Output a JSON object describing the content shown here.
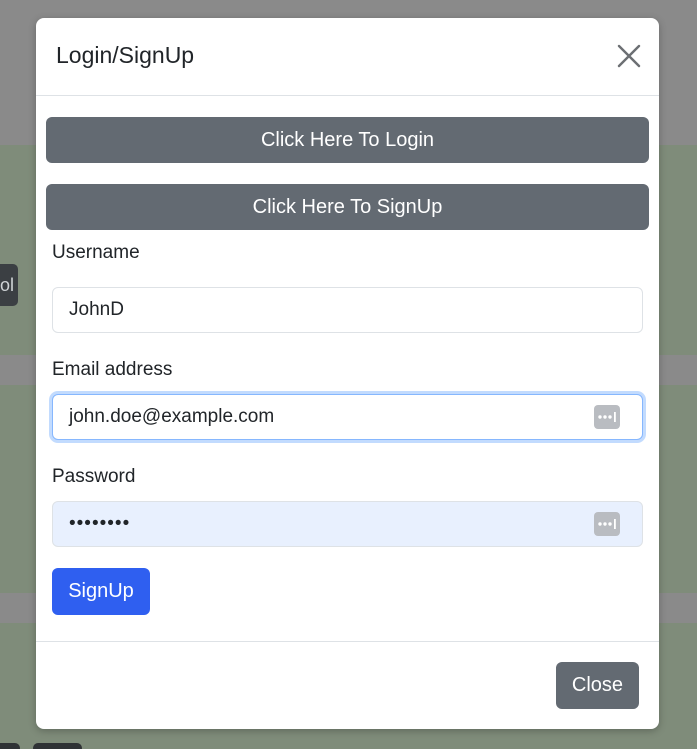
{
  "background": {
    "chip_text": "ol"
  },
  "modal": {
    "title": "Login/SignUp",
    "login_button": "Click Here To Login",
    "signup_toggle_button": "Click Here To SignUp",
    "username": {
      "label": "Username",
      "value": "JohnD"
    },
    "email": {
      "label": "Email address",
      "value": "john.doe@example.com"
    },
    "password": {
      "label": "Password",
      "value": "••••••••"
    },
    "submit_button": "SignUp",
    "close_button": "Close"
  },
  "colors": {
    "primary": "#2f5ff0",
    "secondary": "#636a72",
    "autofill": "#e8f0fe",
    "focus_ring": "#86b7fe"
  },
  "icons": {
    "close": "close-icon",
    "password_manager": "password-key-icon"
  }
}
